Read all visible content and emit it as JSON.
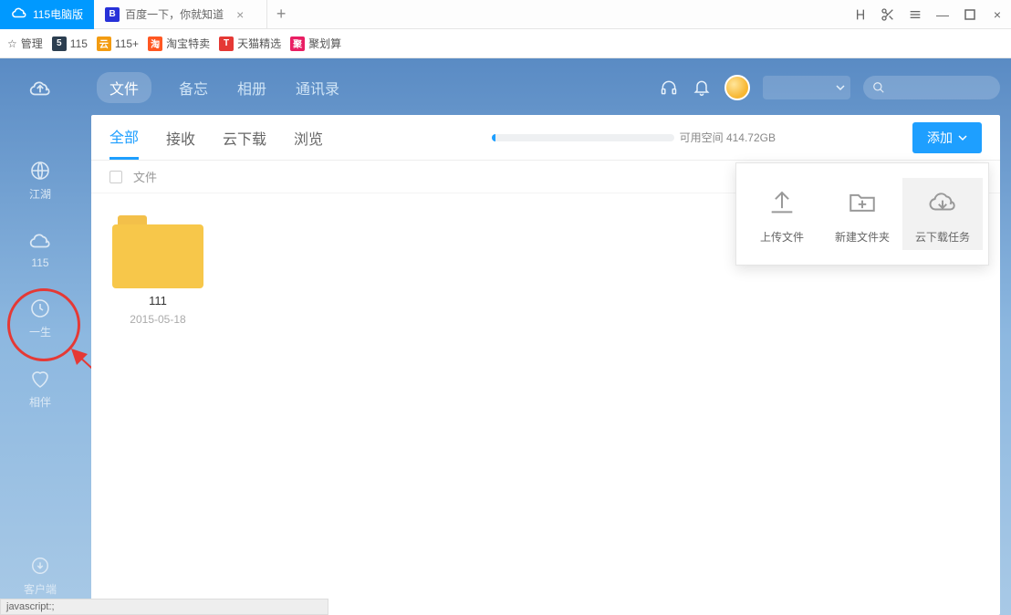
{
  "titlebar": {
    "tab1": {
      "label": "115电脑版"
    },
    "tab2": {
      "label": "百度一下，你就知道"
    }
  },
  "bookmarks": {
    "manage": "管理",
    "b1": "115",
    "b2": "115+",
    "b3": "淘宝特卖",
    "b4": "天猫精选",
    "b5": "聚划算"
  },
  "sidebar": {
    "jianghu": "江湖",
    "s115": "115",
    "yisheng": "一生",
    "xiangban": "相伴",
    "client": "客户端"
  },
  "topnav": {
    "file": "文件",
    "memo": "备忘",
    "album": "相册",
    "contacts": "通讯录"
  },
  "subtabs": {
    "all": "全部",
    "receive": "接收",
    "cloud_dl": "云下载",
    "browse": "浏览",
    "space_label": "可用空间 414.72GB",
    "add": "添加"
  },
  "listhead": {
    "file": "文件"
  },
  "files": [
    {
      "name": "111",
      "date": "2015-05-18"
    }
  ],
  "dropdown": {
    "upload": "上传文件",
    "newfolder": "新建文件夹",
    "cloudtask": "云下载任务"
  },
  "statusbar": "javascript:;"
}
